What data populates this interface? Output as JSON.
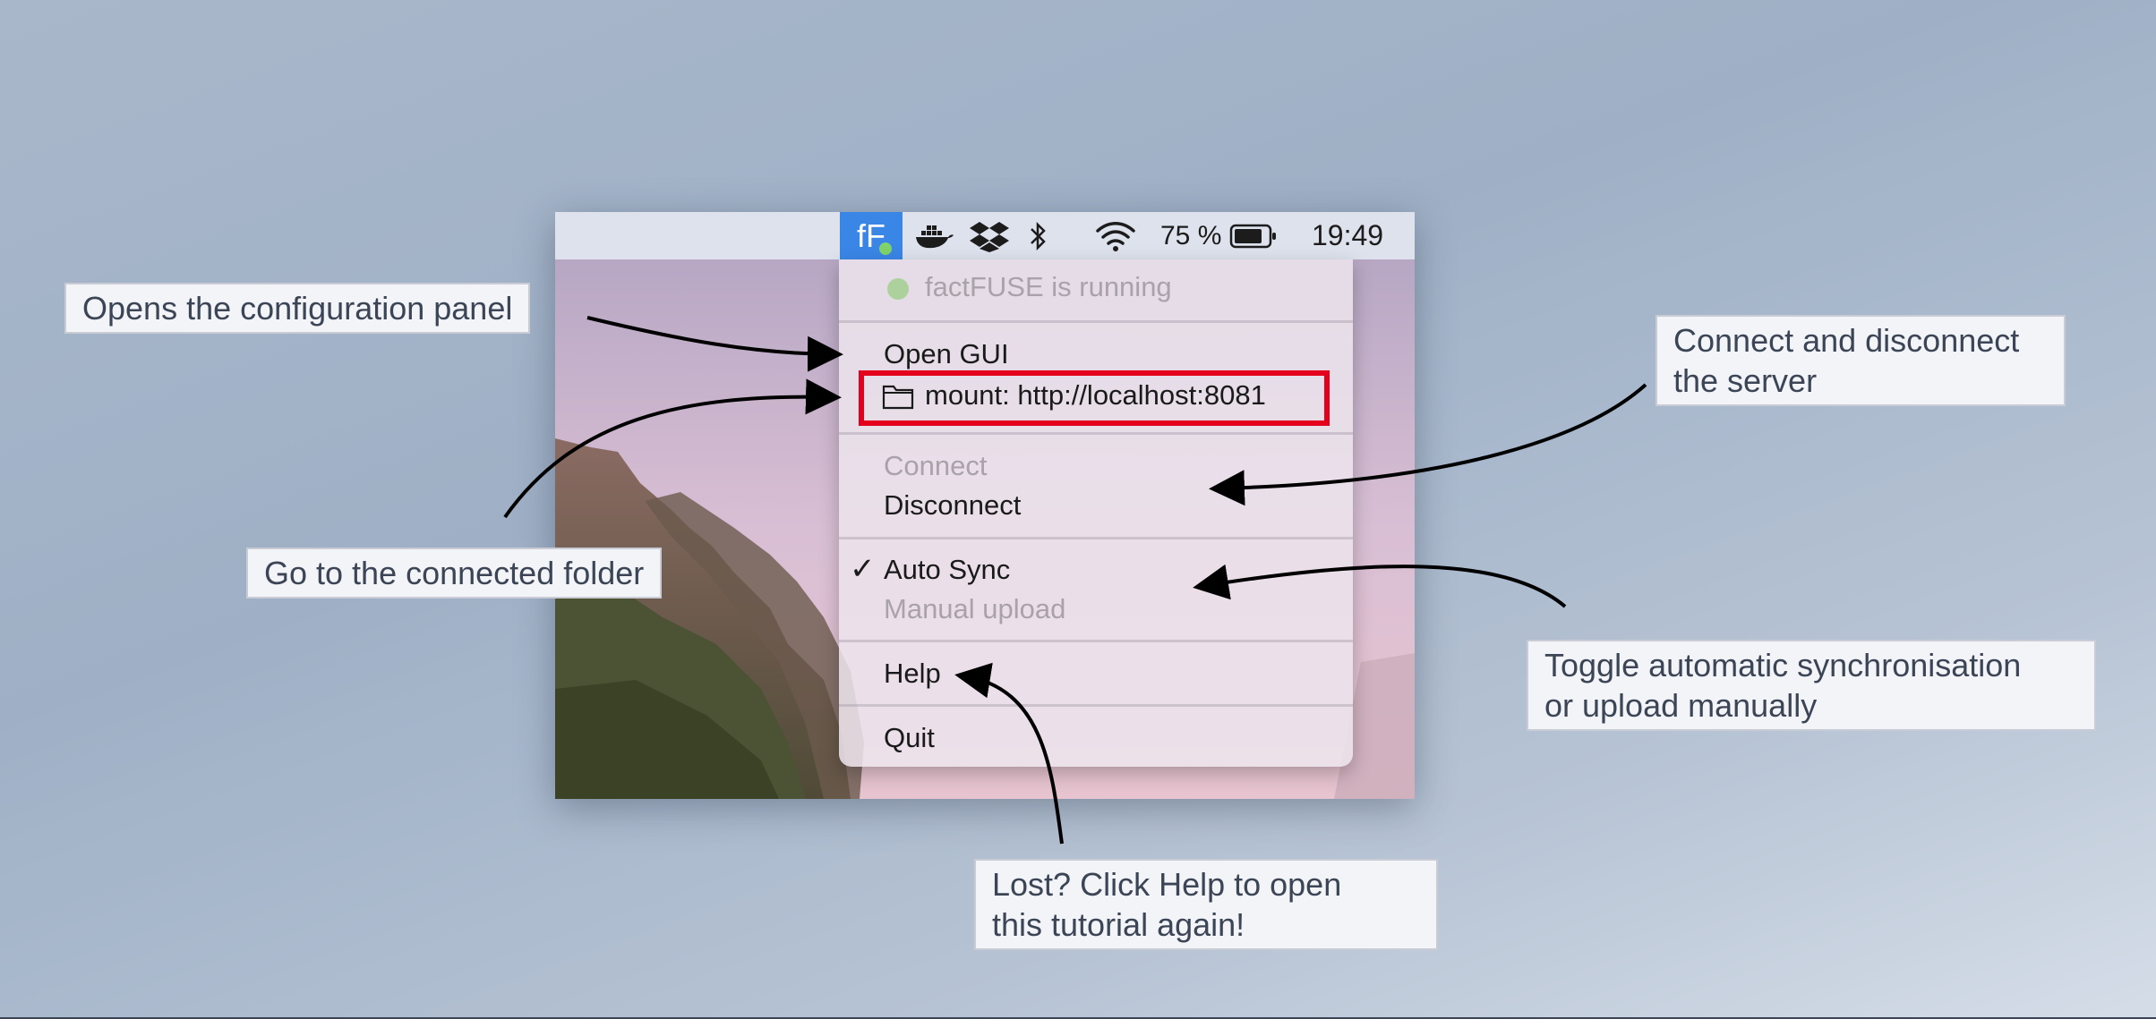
{
  "menubar": {
    "app_label": "fF",
    "battery_text": "75 %",
    "clock": "19:49",
    "icons": [
      "factfuse-app-icon",
      "docker-icon",
      "dropbox-icon",
      "bluetooth-icon",
      "wifi-icon",
      "battery-icon"
    ]
  },
  "menu": {
    "status": "factFUSE is running",
    "open_gui": "Open GUI",
    "mount": "mount: http://localhost:8081",
    "connect": "Connect",
    "disconnect": "Disconnect",
    "checkmark": "✓",
    "auto_sync": "Auto Sync",
    "manual_upload": "Manual upload",
    "help": "Help",
    "quit": "Quit"
  },
  "annotations": {
    "open_config": "Opens the configuration panel",
    "goto_folder": "Go to the connected folder",
    "connect_line1": "Connect and disconnect",
    "connect_line2": "the server",
    "toggle_line1": "Toggle automatic synchronisation",
    "toggle_line2": "or upload manually",
    "help_line1": "Lost? Click Help to open",
    "help_line2": "this tutorial again!"
  },
  "colors": {
    "highlight": "#e4001d",
    "app_accent": "#3a86e6",
    "status_dot": "#9fce8a"
  }
}
